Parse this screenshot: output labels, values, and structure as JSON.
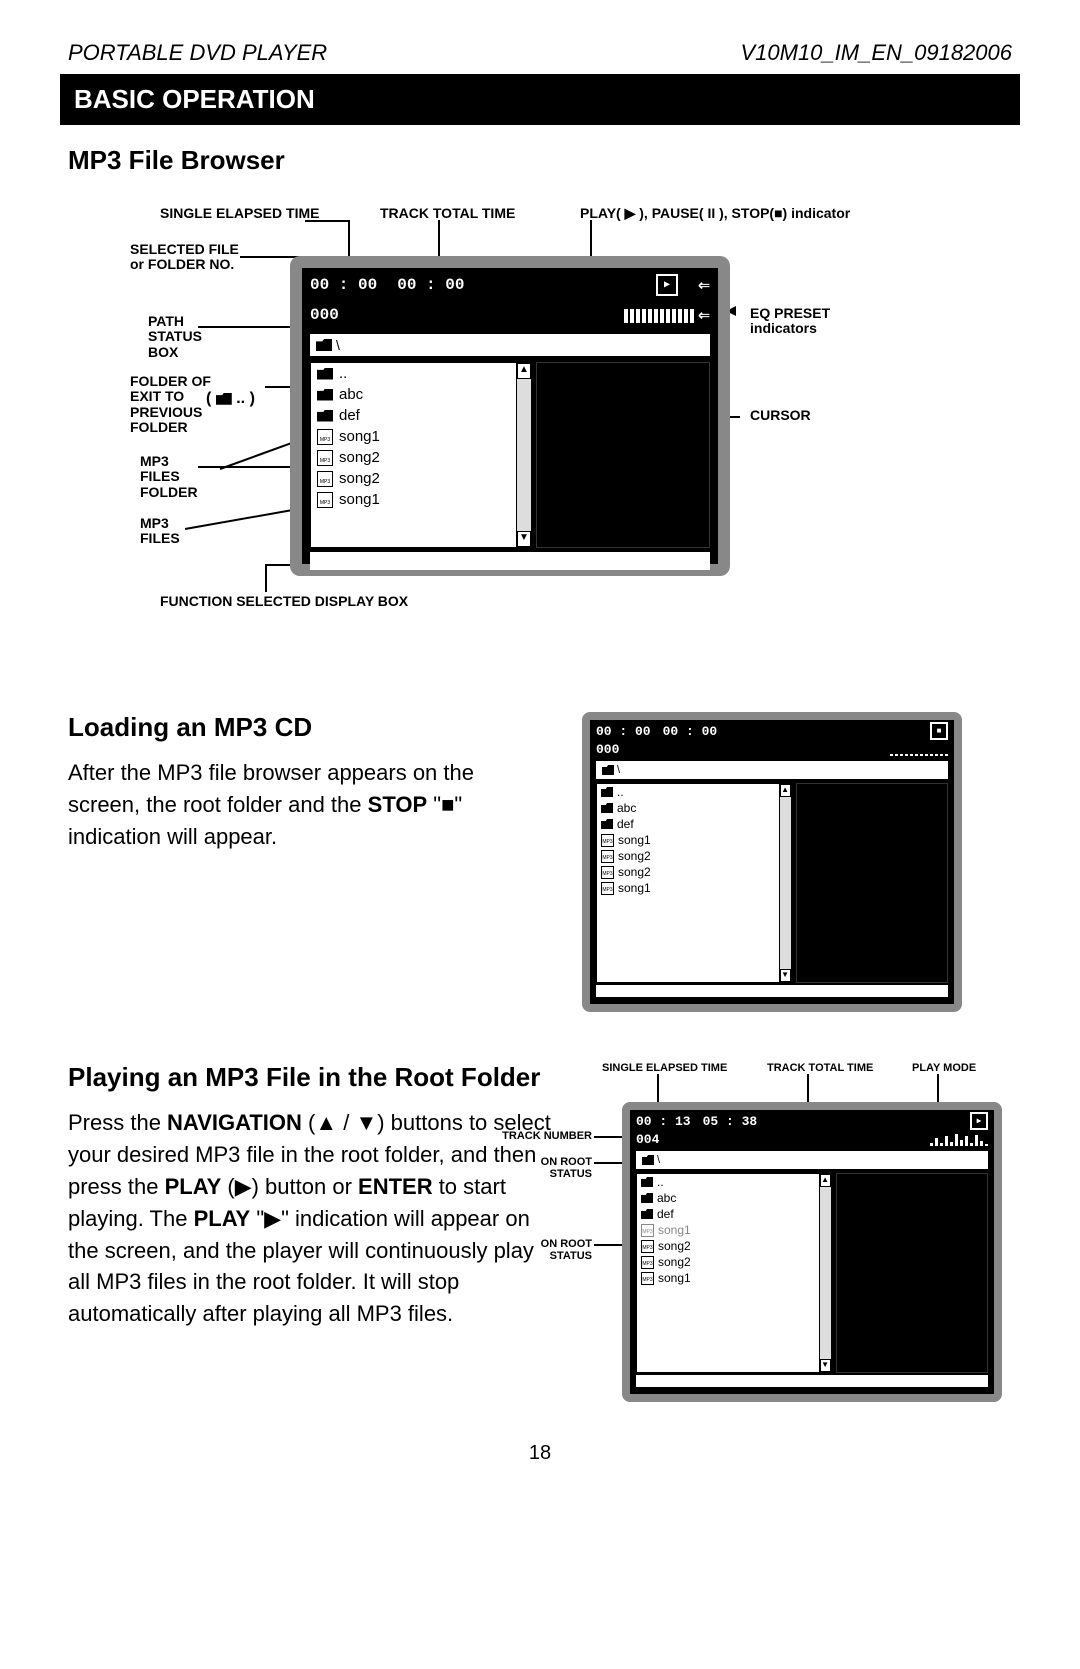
{
  "header": {
    "left": "PORTABLE DVD PLAYER",
    "right": "V10M10_IM_EN_09182006"
  },
  "section_bar": "BASIC OPERATION",
  "title1": "MP3 File Browser",
  "diagram1": {
    "ann_single_elapsed": "SINGLE ELAPSED TIME",
    "ann_track_total": "TRACK TOTAL TIME",
    "ann_play_pause_stop": "PLAY( ▶ ), PAUSE( II ), STOP(■) indicator",
    "ann_selected_file": "SELECTED FILE\nor FOLDER NO.",
    "ann_path": "PATH\nSTATUS\nBOX",
    "ann_folder_exit": "FOLDER OF\nEXIT TO\nPREVIOUS\nFOLDER",
    "ann_folder_exit_glyph": "( 📁 .. )",
    "ann_mp3_folder": "MP3\nFILES\nFOLDER",
    "ann_mp3_files": "MP3\nFILES",
    "ann_func_box": "FUNCTION SELECTED DISPLAY BOX",
    "ann_eq": "EQ PRESET\nindicators",
    "ann_cursor": "CURSOR",
    "time1": "00 : 00",
    "time2": "00 : 00",
    "sel_no": "000",
    "path_icon": "📁 \\",
    "files": [
      {
        "type": "up",
        "label": ".."
      },
      {
        "type": "folder",
        "label": "abc"
      },
      {
        "type": "folder",
        "label": "def"
      },
      {
        "type": "mp3",
        "label": "song1"
      },
      {
        "type": "mp3",
        "label": "song2"
      },
      {
        "type": "mp3",
        "label": "song2"
      },
      {
        "type": "mp3",
        "label": "song1"
      }
    ]
  },
  "title2": "Loading an MP3 CD",
  "para2_a": "After the MP3 file browser appears on the screen, the root folder and the ",
  "para2_b_bold": "STOP",
  "para2_c": " \"■\" indication will appear.",
  "diagram2": {
    "time1": "00 : 00",
    "time2": "00 : 00",
    "sel_no": "000",
    "stop_glyph": "■",
    "files": [
      {
        "type": "up",
        "label": ".."
      },
      {
        "type": "folder",
        "label": "abc"
      },
      {
        "type": "folder",
        "label": "def"
      },
      {
        "type": "mp3",
        "label": "song1"
      },
      {
        "type": "mp3",
        "label": "song2"
      },
      {
        "type": "mp3",
        "label": "song2"
      },
      {
        "type": "mp3",
        "label": "song1"
      }
    ]
  },
  "title3": "Playing an MP3 File in the Root Folder",
  "para3_parts": {
    "a": "Press the ",
    "b_bold": "NAVIGATION",
    "c": " (▲ / ▼) buttons to select your desired MP3 file in the root folder, and then press the ",
    "d_bold": "PLAY",
    "e": " (▶) button or ",
    "f_bold": "ENTER",
    "g": " to start playing. The ",
    "h_bold": "PLAY",
    "i": " \"▶\" indication will appear on the screen, and the player will continuously play all MP3 files in the root folder. It will stop automatically after playing all MP3 files."
  },
  "diagram3": {
    "ann_single_elapsed": "SINGLE ELAPSED TIME",
    "ann_track_total": "TRACK TOTAL TIME",
    "ann_play_mode": "PLAY MODE",
    "ann_track_number": "TRACK NUMBER",
    "ann_on_root_1": "ON ROOT STATUS",
    "ann_on_root_2": "ON ROOT STATUS",
    "time1": "00 : 13",
    "time2": "05 : 38",
    "sel_no": "004",
    "play_glyph": "▶",
    "files": [
      {
        "type": "up",
        "label": ".."
      },
      {
        "type": "folder",
        "label": "abc"
      },
      {
        "type": "folder",
        "label": "def"
      },
      {
        "type": "mp3",
        "label": "song1",
        "selected": true
      },
      {
        "type": "mp3",
        "label": "song2"
      },
      {
        "type": "mp3",
        "label": "song2"
      },
      {
        "type": "mp3",
        "label": "song1"
      }
    ]
  },
  "page_number": "18"
}
